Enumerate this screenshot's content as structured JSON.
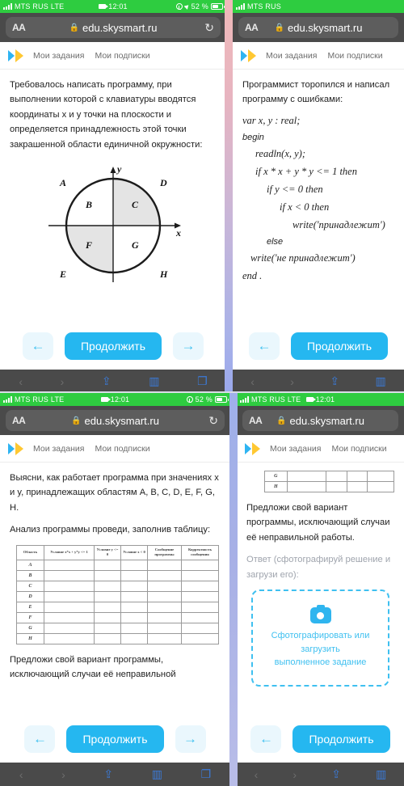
{
  "status_bar": {
    "carrier": "MTS RUS",
    "network": "LTE",
    "time": "12:01",
    "battery_percent": "52 %",
    "signal_icon": "signal-bars-icon",
    "record_icon": "screen-record-icon",
    "lock_icon": "rotation-lock-icon",
    "location_icon": "location-arrow-icon",
    "battery_icon": "battery-icon",
    "charging_icon": "lightning-bolt-icon"
  },
  "browser": {
    "text_size_label": "AA",
    "lock_glyph": "🔒",
    "url": "edu.skysmart.ru",
    "reload_glyph": "↻",
    "toolbar": {
      "back": "‹",
      "forward": "›",
      "share": "share-icon",
      "bookmarks": "book-icon",
      "tabs": "tabs-icon"
    }
  },
  "site_header": {
    "logo": "skysmart-logo",
    "nav": [
      "Мои задания",
      "Мои подписки"
    ]
  },
  "panels": {
    "top_left": {
      "paragraph": "Требовалось написать программу, при выполнении которой с клавиатуры вводятся координаты x и y точки на плоскости и определяется принадлежность этой точки закрашенной области единичной окружности:",
      "figure": {
        "name": "unit-circle-regions-diagram",
        "axis_x_label": "x",
        "axis_y_label": "y",
        "outside_labels": [
          "A",
          "D",
          "E",
          "H"
        ],
        "inside_labels": [
          "B",
          "C",
          "F",
          "G"
        ],
        "shaded_regions": [
          "C",
          "F"
        ]
      }
    },
    "top_right": {
      "paragraph": "Программист торопился и написал программу с ошибками:",
      "code": [
        "var x, y : real;",
        "begin",
        "readln(x, y);",
        "if x * x + y * y <= 1 then",
        "if y <= 0 then",
        "if x < 0 then",
        "write('принадлежит')",
        "else",
        "write('не принадлежит')",
        "end ."
      ]
    },
    "bottom_left": {
      "paragraph1": "Выясни, как работает программа при значениях x и y, принадлежащих областям A, B, C, D, E, F, G, H.",
      "paragraph2": "Анализ программы проведи, заполнив таблицу:",
      "paragraph3": "Предложи свой вариант программы, исключающий случаи её неправильной"
    },
    "bottom_right": {
      "paragraph1": "Предложи свой вариант программы, исключающий случаи её неправильной работы.",
      "paragraph2": "Ответ (сфотографируй решение и загрузи его):",
      "upload": {
        "icon": "camera-icon",
        "line1": "Сфотографировать или загрузить",
        "line2": "выполненное задание"
      }
    }
  },
  "table": {
    "headers": [
      "Область",
      "Условие x*x + y*y <= 1",
      "Условие y <= 0",
      "Условие x < 0",
      "Сообщение программы",
      "Корректность сообщения"
    ],
    "rows": [
      "A",
      "B",
      "C",
      "D",
      "E",
      "F",
      "G",
      "H"
    ]
  },
  "footer": {
    "prev_icon": "←",
    "continue_label": "Продолжить",
    "next_icon": "→"
  },
  "colors": {
    "accent": "#25b7f0",
    "accent_light": "#3fc0f0",
    "status_bar": "#2ecc40",
    "chrome": "#4a4a4a"
  }
}
